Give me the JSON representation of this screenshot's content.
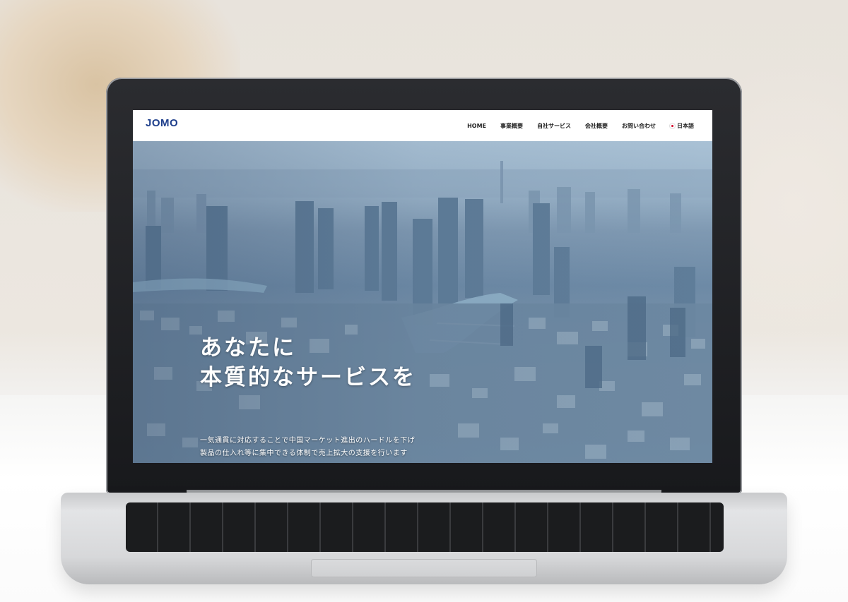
{
  "site": {
    "logo": "JOMO",
    "nav": {
      "home": "HOME",
      "business": "事業概要",
      "services": "自社サービス",
      "company": "会社概要",
      "contact": "お問い合わせ",
      "language": "日本語"
    },
    "hero": {
      "title_line1": "あなたに",
      "title_line2": "本質的なサービスを",
      "sub_line1": "一気通貫に対応することで中国マーケット進出のハードルを下げ",
      "sub_line2": "製品の仕入れ等に集中できる体制で売上拡大の支援を行います"
    }
  },
  "colors": {
    "logo": "#1f3f8c",
    "nav_text": "#222222",
    "hero_text": "#ffffff"
  },
  "icons": {
    "language_flag": "japan-flag-icon"
  }
}
